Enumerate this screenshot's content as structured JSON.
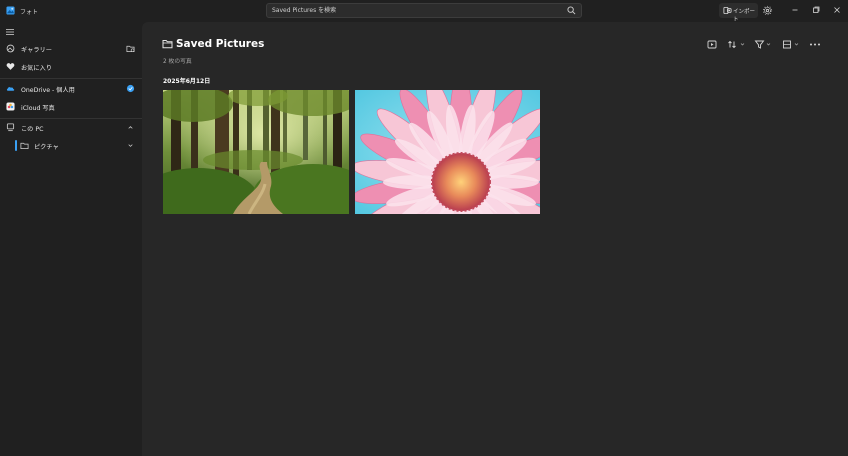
{
  "window": {
    "app_title": "フォト",
    "search_placeholder": "Saved Pictures を検索",
    "import_label": "インポート"
  },
  "sidebar": {
    "items": [
      {
        "label": "ギャラリー",
        "icon": "gallery-icon"
      },
      {
        "label": "お気に入り",
        "icon": "heart-icon"
      },
      {
        "label": "OneDrive - 個人用",
        "icon": "onedrive-cloud-icon"
      },
      {
        "label": "iCloud 写真",
        "icon": "icloud-photos-icon"
      },
      {
        "label": "この PC",
        "icon": "pc-icon"
      },
      {
        "label": "ピクチャ",
        "icon": "folder-icon"
      }
    ]
  },
  "main": {
    "title": "Saved Pictures",
    "photo_count": "2 枚の写真",
    "date_heading": "2025年6月12日",
    "photos": [
      {
        "name": "forest-path-photo",
        "subject": "forest path"
      },
      {
        "name": "pink-flower-photo",
        "subject": "pink daisy flower"
      }
    ]
  },
  "colors": {
    "accent": "#3aa0f3",
    "background": "#202020",
    "content": "#272727"
  }
}
